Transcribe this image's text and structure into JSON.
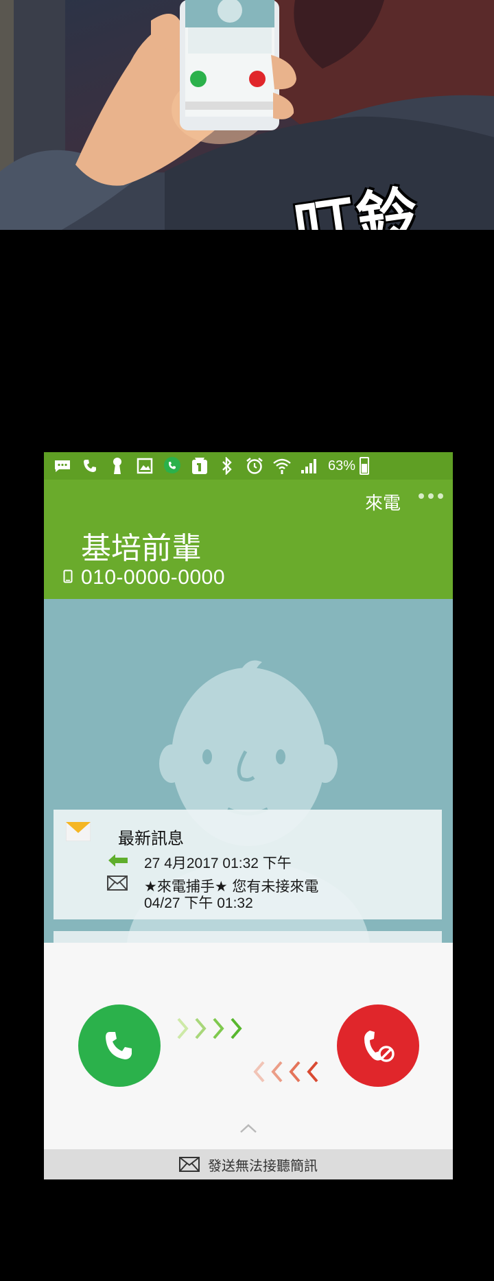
{
  "comic": {
    "sfx_text": "叮鈴"
  },
  "status_bar": {
    "battery_percent": "63%",
    "icons": [
      "message-icon",
      "phone-icon",
      "keyhole-icon",
      "gallery-icon",
      "phone-bubble-icon",
      "notification-icon",
      "bluetooth-icon",
      "alarm-icon",
      "wifi-icon",
      "signal-icon",
      "battery-icon"
    ]
  },
  "call": {
    "label": "來電",
    "caller_name": "基培前輩",
    "caller_number": "010-0000-0000"
  },
  "message_card": {
    "title": "最新訊息",
    "call_log_time": "27 4月2017 01:32 下午",
    "message_text": "★來電捕手★ 您有未接來電",
    "message_time": "04/27 下午 01:32"
  },
  "actions": {
    "answer_icon": "phone-answer-icon",
    "decline_icon": "phone-decline-icon",
    "reject_with_message_label": "發送無法接聽簡訊"
  },
  "colors": {
    "header_green": "#6aab2c",
    "status_green": "#5f9f24",
    "answer_green": "#2bb14b",
    "decline_red": "#e0262b",
    "background_teal": "#86b6bc"
  }
}
